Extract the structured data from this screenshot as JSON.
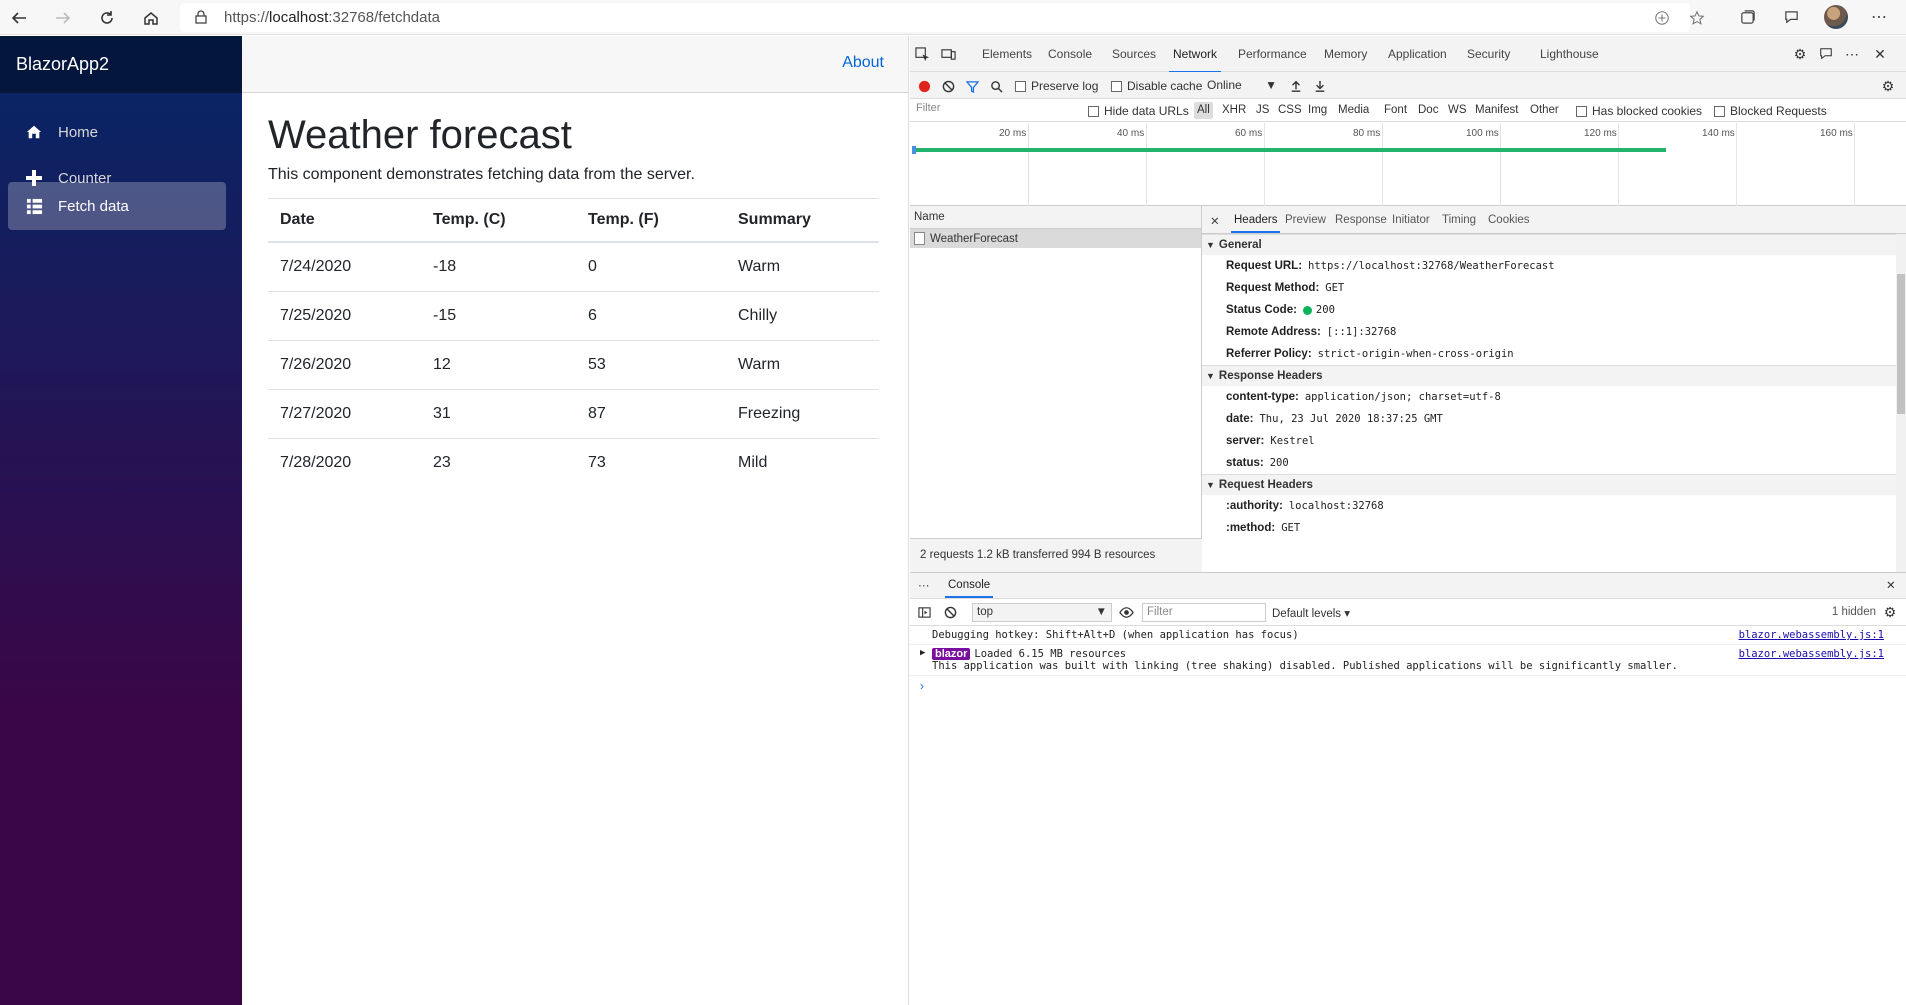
{
  "browser": {
    "url_prefix": "https://",
    "url_host": "localhost",
    "url_rest": ":32768/fetchdata"
  },
  "sidebar": {
    "brand": "BlazorApp2",
    "items": [
      {
        "label": "Home",
        "icon": "home-icon"
      },
      {
        "label": "Counter",
        "icon": "plus-icon"
      },
      {
        "label": "Fetch data",
        "icon": "list-icon",
        "active": true
      }
    ]
  },
  "topbar": {
    "about": "About"
  },
  "page": {
    "title": "Weather forecast",
    "description": "This component demonstrates fetching data from the server.",
    "columns": [
      "Date",
      "Temp. (C)",
      "Temp. (F)",
      "Summary"
    ],
    "rows": [
      [
        "7/24/2020",
        "-18",
        "0",
        "Warm"
      ],
      [
        "7/25/2020",
        "-15",
        "6",
        "Chilly"
      ],
      [
        "7/26/2020",
        "12",
        "53",
        "Warm"
      ],
      [
        "7/27/2020",
        "31",
        "87",
        "Freezing"
      ],
      [
        "7/28/2020",
        "23",
        "73",
        "Mild"
      ]
    ]
  },
  "devtools": {
    "tabs": [
      "Elements",
      "Console",
      "Sources",
      "Network",
      "Performance",
      "Memory",
      "Application",
      "Security",
      "Lighthouse"
    ],
    "active_tab": "Network",
    "toolbar": {
      "preserve_log": "Preserve log",
      "disable_cache": "Disable cache",
      "throttle": "Online"
    },
    "filter": {
      "placeholder": "Filter",
      "hide_data_urls": "Hide data URLs",
      "types": [
        "All",
        "XHR",
        "JS",
        "CSS",
        "Img",
        "Media",
        "Font",
        "Doc",
        "WS",
        "Manifest",
        "Other"
      ],
      "has_blocked_cookies": "Has blocked cookies",
      "blocked_requests": "Blocked Requests"
    },
    "timeline_ticks": [
      "20 ms",
      "40 ms",
      "60 ms",
      "80 ms",
      "100 ms",
      "120 ms",
      "140 ms",
      "160 ms"
    ],
    "requests": {
      "header": "Name",
      "items": [
        "WeatherForecast"
      ],
      "summary": "2 requests  1.2 kB transferred  994 B resources"
    },
    "details": {
      "tabs": [
        "Headers",
        "Preview",
        "Response",
        "Initiator",
        "Timing",
        "Cookies"
      ],
      "general_title": "General",
      "general": [
        {
          "k": "Request URL:",
          "v": "https://localhost:32768/WeatherForecast"
        },
        {
          "k": "Request Method:",
          "v": "GET"
        },
        {
          "k": "Status Code:",
          "v": "200"
        },
        {
          "k": "Remote Address:",
          "v": "[::1]:32768"
        },
        {
          "k": "Referrer Policy:",
          "v": "strict-origin-when-cross-origin"
        }
      ],
      "response_title": "Response Headers",
      "response": [
        {
          "k": "content-type:",
          "v": "application/json; charset=utf-8"
        },
        {
          "k": "date:",
          "v": "Thu, 23 Jul 2020 18:37:25 GMT"
        },
        {
          "k": "server:",
          "v": "Kestrel"
        },
        {
          "k": "status:",
          "v": "200"
        }
      ],
      "request_title": "Request Headers",
      "request": [
        {
          "k": ":authority:",
          "v": "localhost:32768"
        },
        {
          "k": ":method:",
          "v": "GET"
        }
      ]
    },
    "drawer": {
      "tab": "Console",
      "context": "top",
      "filter_placeholder": "Filter",
      "levels": "Default levels ▾",
      "hidden": "1 hidden",
      "messages": [
        {
          "text": "Debugging hotkey: Shift+Alt+D (when application has focus)",
          "source": "blazor.webassembly.js:1"
        },
        {
          "badge": "blazor",
          "text": "Loaded 6.15 MB resources",
          "sub": "This application was built with linking (tree shaking) disabled. Published applications will be significantly smaller.",
          "source": "blazor.webassembly.js:1"
        }
      ]
    }
  },
  "colors": {
    "accent": "#1a73e8",
    "link": "#0366d6",
    "status_ok": "#0ab35a",
    "badge": "#7a0ea0"
  }
}
